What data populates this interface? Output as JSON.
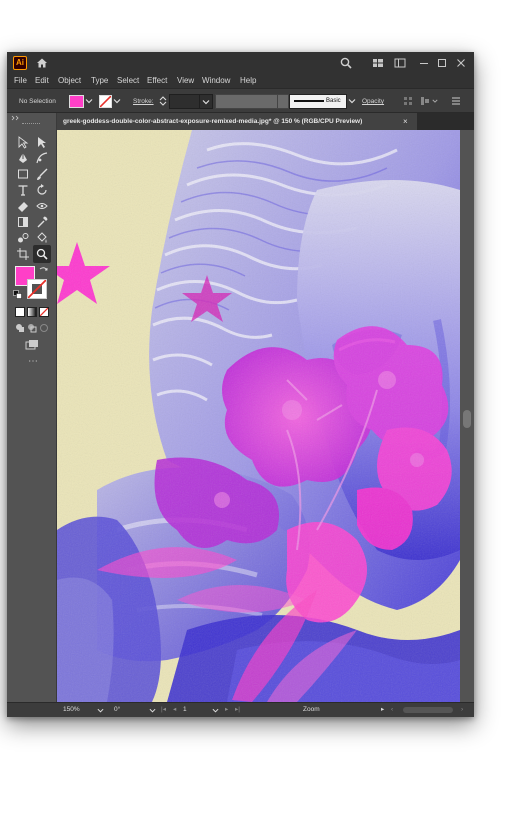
{
  "app": {
    "logo_text": "Ai"
  },
  "menu": [
    "File",
    "Edit",
    "Object",
    "Type",
    "Select",
    "Effect",
    "View",
    "Window",
    "Help"
  ],
  "control": {
    "selection": "No Selection",
    "stroke_label": "Stroke:",
    "brush_label": "Basic",
    "opacity_label": "Opacity",
    "fill_color": "#ff3fc7"
  },
  "document": {
    "tab_title": "greek-goddess-double-color-abstract-exposure-remixed-media.jpg* @ 150 % (RGB/CPU Preview)",
    "close_glyph": "×"
  },
  "status": {
    "zoom": "150%",
    "rotation": "0°",
    "artboard": "1",
    "tool_name": "Zoom"
  },
  "colors": {
    "canvas_bg": "#ebe5b8",
    "magenta": "#ff2fd0",
    "statue_violet": "#5a4ee0"
  },
  "icons": [
    "home-icon",
    "search-icon",
    "arrange-documents-icon",
    "panel-icon",
    "minimize-icon",
    "maximize-icon",
    "close-icon"
  ]
}
